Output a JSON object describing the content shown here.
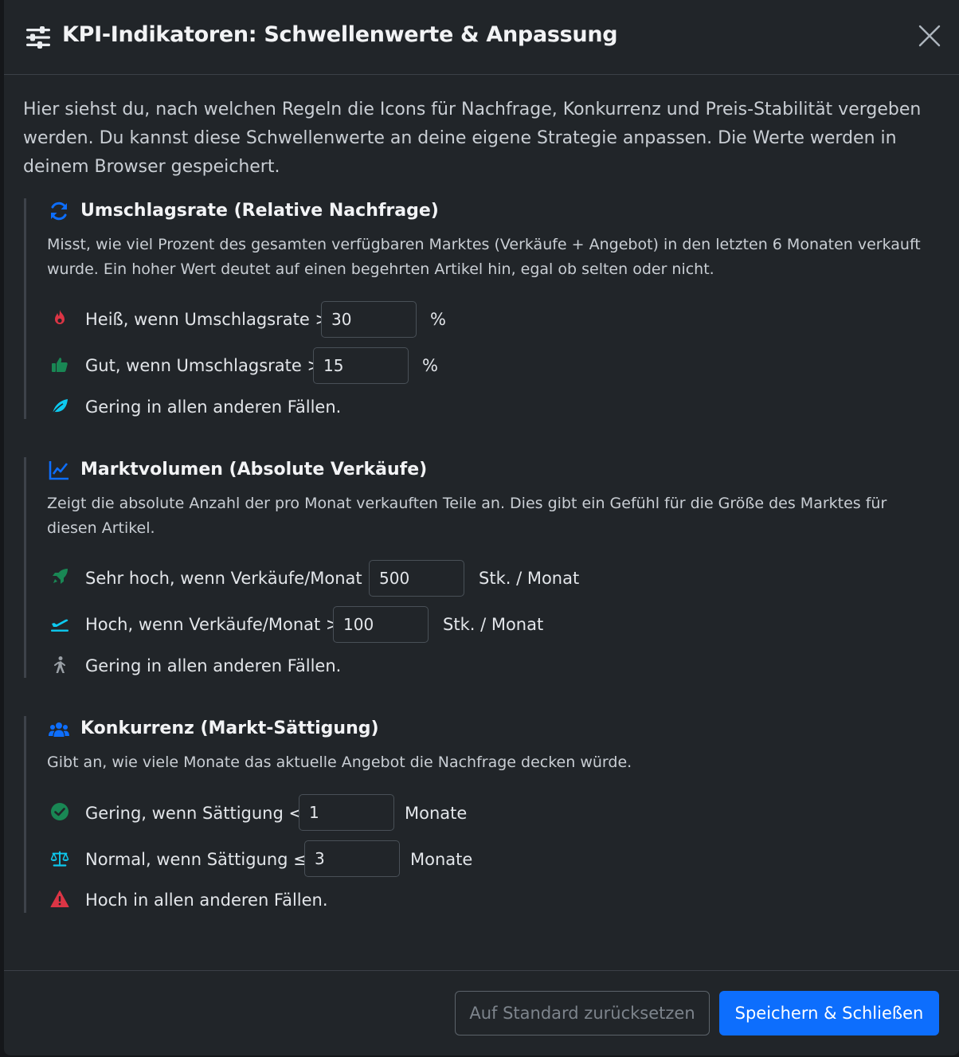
{
  "header": {
    "title": "KPI-Indikatoren: Schwellenwerte & Anpassung",
    "icon": "sliders-icon",
    "close_icon": "close-icon"
  },
  "intro": "Hier siehst du, nach welchen Regeln die Icons für Nachfrage, Konkurrenz und Preis-Stabilität vergeben werden. Du kannst diese Schwellenwerte an deine eigene Strategie anpassen. Die Werte werden in deinem Browser gespeichert.",
  "sections": [
    {
      "title": "Umschlagsrate (Relative Nachfrage)",
      "icon": "sync-icon",
      "description": "Misst, wie viel Prozent des gesamten verfügbaren Marktes (Verkäufe + Angebot) in den letzten 6 Monaten verkauft wurde. Ein hoher Wert deutet auf einen begehrten Artikel hin, egal ob selten oder nicht.",
      "rows": [
        {
          "icon": "fire-icon",
          "label": "Heiß, wenn Umschlagsrate >",
          "value": "30",
          "unit": "%"
        },
        {
          "icon": "thumbs-up-icon",
          "label": "Gut, wenn Umschlagsrate >",
          "value": "15",
          "unit": "%"
        },
        {
          "icon": "leaf-icon",
          "label": "Gering in allen anderen Fällen."
        }
      ]
    },
    {
      "title": "Marktvolumen (Absolute Verkäufe)",
      "icon": "line-chart-icon",
      "description": "Zeigt die absolute Anzahl der pro Monat verkauften Teile an. Dies gibt ein Gefühl für die Größe des Marktes für diesen Artikel.",
      "rows": [
        {
          "icon": "rocket-icon",
          "label": "Sehr hoch, wenn Verkäufe/Monat >",
          "value": "500",
          "unit": "Stk. / Monat"
        },
        {
          "icon": "plane-departure-icon",
          "label": "Hoch, wenn Verkäufe/Monat >",
          "value": "100",
          "unit": "Stk. / Monat"
        },
        {
          "icon": "walking-icon",
          "label": "Gering in allen anderen Fällen."
        }
      ]
    },
    {
      "title": "Konkurrenz (Markt-Sättigung)",
      "icon": "users-icon",
      "description": "Gibt an, wie viele Monate das aktuelle Angebot die Nachfrage decken würde.",
      "rows": [
        {
          "icon": "check-circle-icon",
          "label": "Gering, wenn Sättigung <",
          "value": "1",
          "unit": "Monate"
        },
        {
          "icon": "balance-scale-icon",
          "label": "Normal, wenn Sättigung ≤",
          "value": "3",
          "unit": "Monate"
        },
        {
          "icon": "warning-triangle-icon",
          "label": "Hoch in allen anderen Fällen."
        }
      ]
    }
  ],
  "footer": {
    "reset_label": "Auf Standard zurücksetzen",
    "save_label": "Speichern & Schließen"
  },
  "colors": {
    "accent": "#0d6efd",
    "fire": "#dc3545",
    "thumbs": "#198754",
    "leaf": "#0dcaf0",
    "walking": "#9aa0a6",
    "warning": "#dc3545"
  }
}
